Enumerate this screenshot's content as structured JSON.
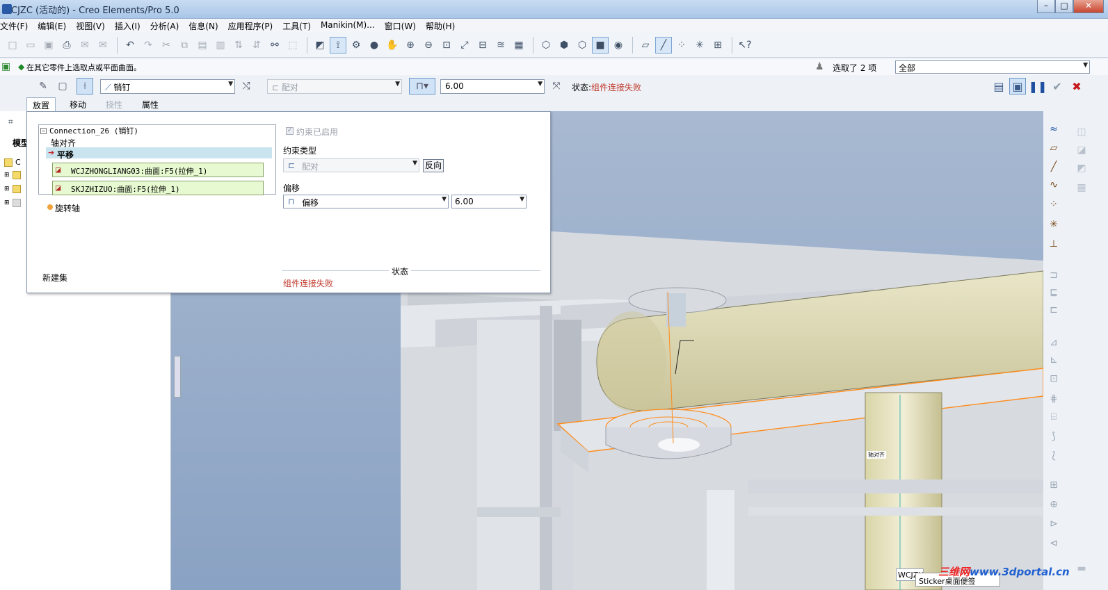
{
  "window": {
    "title": "CJZC (活动的) - Creo Elements/Pro 5.0",
    "controls": {
      "minimize": "–",
      "maximize": "□",
      "close": "✕"
    }
  },
  "menu": [
    "文件(F)",
    "编辑(E)",
    "视图(V)",
    "插入(I)",
    "分析(A)",
    "信息(N)",
    "应用程序(P)",
    "工具(T)",
    "Manikin(M)...",
    "窗口(W)",
    "帮助(H)"
  ],
  "toolbar": {
    "icons": [
      "new-icon",
      "open-icon",
      "save-icon",
      "print-icon",
      "email-icon",
      "email-link-icon",
      "undo-icon",
      "redo-icon",
      "cut-icon",
      "copy-icon",
      "paste-icon",
      "paste-special-icon",
      "regenerate-icon",
      "regen-manager-icon",
      "find-icon",
      "select-box-icon",
      "datum-display-icon",
      "spin-center-icon",
      "view-manager-icon",
      "display-style-icon",
      "pan-icon",
      "zoom-in-icon",
      "zoom-out-icon",
      "refit-icon",
      "reorient-icon",
      "saved-views-icon",
      "layers-icon",
      "appearance-icon",
      "wireframe-icon",
      "hidden-line-icon",
      "no-hidden-icon",
      "shading-icon",
      "enhanced-realism-icon",
      "datum-planes-icon",
      "datum-axes-icon",
      "datum-points-icon",
      "coordinate-systems-icon",
      "annotation-icon",
      "whats-this-icon"
    ]
  },
  "message": {
    "text": "在其它零件上选取点或平面曲面。",
    "selection_count": "选取了 2 项",
    "filter": "全部"
  },
  "dashboard": {
    "connection_type": "销钉",
    "constraint": "配对",
    "offset_value": "6.00",
    "status_label": "状态:",
    "status_value": "组件连接失败",
    "tabs": [
      {
        "label": "放置",
        "state": "active"
      },
      {
        "label": "移动",
        "state": "normal"
      },
      {
        "label": "挠性",
        "state": "disabled"
      },
      {
        "label": "属性",
        "state": "normal"
      }
    ]
  },
  "model_tree": {
    "title": "模型",
    "items": [
      "C",
      "",
      "",
      ""
    ]
  },
  "placement": {
    "connection_title": "Connection_26 (销钉)",
    "axis_align": "轴对齐",
    "translation": "平移",
    "ref1": "WCJZHONGLIANG03:曲面:F5(拉伸_1)",
    "ref2": "SKJZHIZUO:曲面:F5(拉伸_1)",
    "rotation_axis": "旋转轴",
    "new_set": "新建集",
    "constraint_enabled": "约束已启用",
    "constraint_type_label": "约束类型",
    "constraint_type": "配对",
    "flip": "反向",
    "offset_label": "偏移",
    "offset_type": "偏移",
    "offset_value": "6.00",
    "status_label": "状态",
    "status_value": "组件连接失败"
  },
  "viewport": {
    "label_tag": "轴对齐",
    "colors": {
      "background": "#93a9c8",
      "part": "#dfe3e8",
      "beam": "#d8d3a6",
      "highlight": "#ff8c1a"
    }
  },
  "bottom": {
    "tag": "WCJZHO",
    "sticker": "Sticker桌面便签",
    "watermark": "三维网",
    "watermark_url": "www.3dportal.cn"
  }
}
